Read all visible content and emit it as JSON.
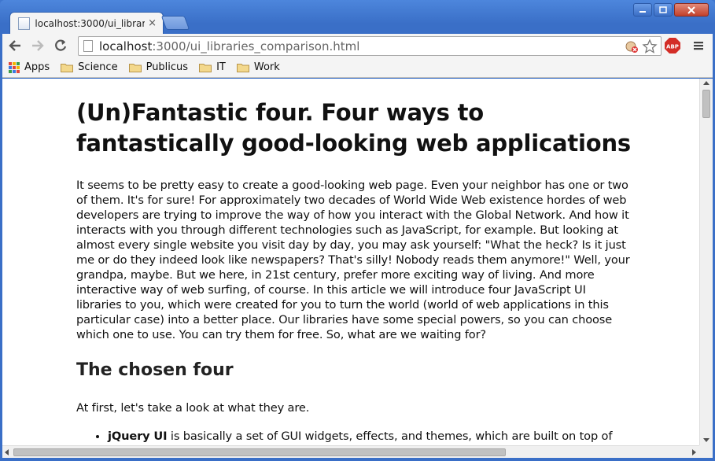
{
  "window": {
    "controls": [
      "minimize",
      "maximize",
      "close"
    ]
  },
  "tab": {
    "title": "localhost:3000/ui_librar",
    "close_label": "×",
    "favicon": "page-icon"
  },
  "toolbar": {
    "url_host": "localhost",
    "url_rest": ":3000/ui_libraries_comparison.html",
    "icons": [
      "back-arrow-icon",
      "forward-arrow-icon",
      "reload-icon",
      "cookie-blocked-icon",
      "star-icon",
      "adblock-plus-icon",
      "menu-icon"
    ],
    "abp_label": "ABP"
  },
  "bookmarks": {
    "items": [
      {
        "label": "Apps",
        "icon": "apps-grid-icon"
      },
      {
        "label": "Science",
        "icon": "folder-icon"
      },
      {
        "label": "Publicus",
        "icon": "folder-icon"
      },
      {
        "label": "IT",
        "icon": "folder-icon"
      },
      {
        "label": "Work",
        "icon": "folder-icon"
      }
    ]
  },
  "article": {
    "title": "(Un)Fantastic four. Four ways to fantastically good-looking web applications",
    "paragraph1": "It seems to be pretty easy to create a good-looking web page. Even your neighbor has one or two of them. It's for sure! For approximately two decades of World Wide Web existence hordes of web developers are trying to improve the way of how you interact with the Global Network. And how it interacts with you through different technologies such as JavaScript, for example. But looking at almost every single website you visit day by day, you may ask yourself: \"What the heck? Is it just me or do they indeed look like newspapers? That's silly! Nobody reads them anymore!\" Well, your grandpa, maybe. But we here, in 21st century, prefer more exciting way of living. And more interactive way of web surfing, of course. In this article we will introduce four JavaScript UI libraries to you, which were created for you to turn the world (world of web applications in this particular case) into a better place. Our libraries have some special powers, so you can choose which one to use. You can try them for free. So, what are we waiting for?",
    "section_heading": "The chosen four",
    "intro": "At first, let's take a look at what they are.",
    "list": [
      {
        "name": "jQuery UI",
        "text": " is basically a set of GUI widgets, effects, and themes, which are built on top of the jQuery (not a typo. It's actually starts with lowercase 'j') JavaScript library. You might"
      }
    ]
  },
  "colors": {
    "titlebar": "#3a6fc7",
    "chrome": "#f4f4f4",
    "abp_red": "#d32d27"
  }
}
